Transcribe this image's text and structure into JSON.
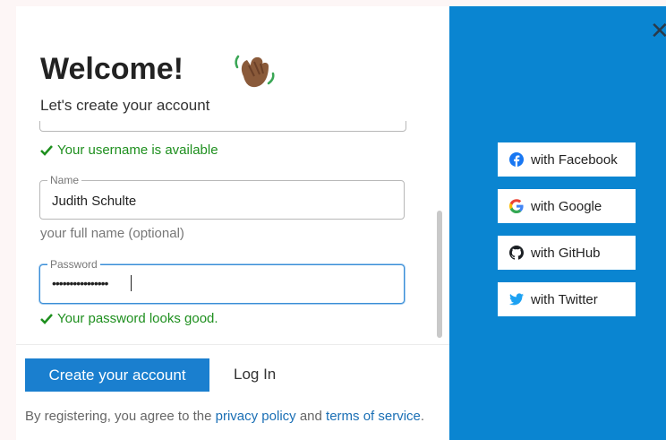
{
  "dialog": {
    "title": "Welcome!",
    "subtitle": "Let's create your account",
    "close_glyph": "✕"
  },
  "username": {
    "status": "Your username is available"
  },
  "name_field": {
    "label": "Name",
    "value": "Judith Schulte",
    "hint": "your full name (optional)"
  },
  "password_field": {
    "label": "Password",
    "value": "••••••••••••••••",
    "status": "Your password looks good."
  },
  "actions": {
    "create_label": "Create your account",
    "login_label": "Log In"
  },
  "legal": {
    "prefix": "By registering, you agree to the ",
    "privacy_label": "privacy policy",
    "middle": " and ",
    "terms_label": "terms of service",
    "suffix": "."
  },
  "social": [
    {
      "label": "with Facebook",
      "icon": "facebook-icon"
    },
    {
      "label": "with Google",
      "icon": "google-icon"
    },
    {
      "label": "with GitHub",
      "icon": "github-icon"
    },
    {
      "label": "with Twitter",
      "icon": "twitter-icon"
    }
  ],
  "colors": {
    "accent": "#1a7fcf",
    "side_panel": "#0a85d1",
    "success": "#1e8f1e",
    "link": "#1a6fb5"
  }
}
